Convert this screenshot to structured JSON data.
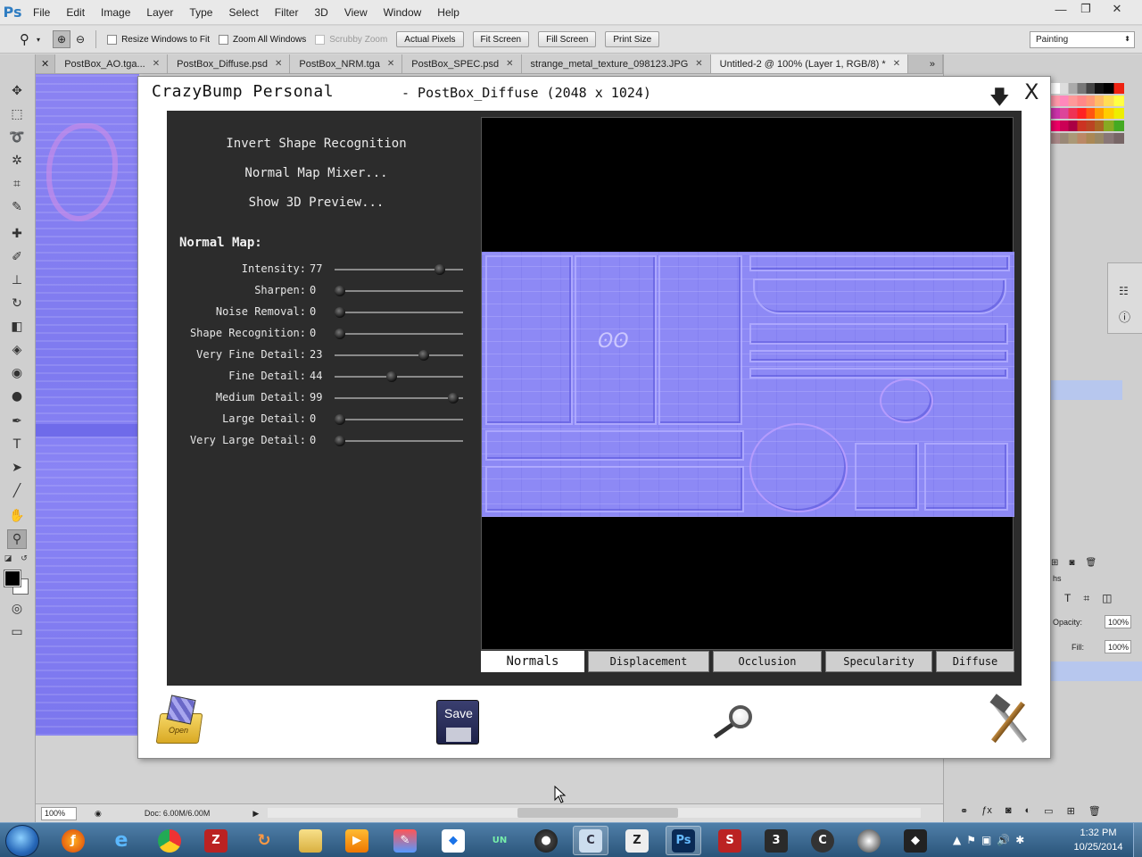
{
  "app": {
    "logo": "Ps"
  },
  "menu": [
    "File",
    "Edit",
    "Image",
    "Layer",
    "Type",
    "Select",
    "Filter",
    "3D",
    "View",
    "Window",
    "Help"
  ],
  "window_controls": {
    "minimize": "—",
    "restore": "❐",
    "close": "✕"
  },
  "options_bar": {
    "resize_windows": "Resize Windows to Fit",
    "zoom_all": "Zoom All Windows",
    "scrubby_zoom": "Scrubby Zoom",
    "actual_pixels": "Actual Pixels",
    "fit_screen": "Fit Screen",
    "fill_screen": "Fill Screen",
    "print_size": "Print Size",
    "workspace": "Painting"
  },
  "tabs": [
    {
      "label": "PostBox_AO.tga..."
    },
    {
      "label": "PostBox_Diffuse.psd"
    },
    {
      "label": "PostBox_NRM.tga"
    },
    {
      "label": "PostBox_SPEC.psd"
    },
    {
      "label": "strange_metal_texture_098123.JPG"
    },
    {
      "label": "Untitled-2 @ 100% (Layer 1, RGB/8) *",
      "active": true
    }
  ],
  "tabs_overflow": "»",
  "status": {
    "zoom": "100%",
    "doc": "Doc: 6.00M/6.00M"
  },
  "right_panel": {
    "opacity_label": "Opacity:",
    "opacity_value": "100%",
    "fill_label": "Fill:",
    "fill_value": "100%",
    "paths_tab": "hs"
  },
  "crazybump": {
    "title": "CrazyBump Personal",
    "file": "- PostBox_Diffuse (2048 x 1024)",
    "links": [
      "Invert Shape Recognition",
      "Normal Map Mixer...",
      "Show 3D Preview..."
    ],
    "heading": "Normal Map:",
    "sliders": [
      {
        "label": "Intensity:",
        "value": "77",
        "level": 0.85
      },
      {
        "label": "Sharpen:",
        "value": "0",
        "level": 0.0
      },
      {
        "label": "Noise Removal:",
        "value": "0",
        "level": 0.0
      },
      {
        "label": "Shape Recognition:",
        "value": "0",
        "level": 0.0
      },
      {
        "label": "Very Fine Detail:",
        "value": "23",
        "level": 0.71
      },
      {
        "label": "Fine Detail:",
        "value": "44",
        "level": 0.44
      },
      {
        "label": "Medium Detail:",
        "value": "99",
        "level": 0.96
      },
      {
        "label": "Large Detail:",
        "value": "0",
        "level": 0.0
      },
      {
        "label": "Very Large Detail:",
        "value": "0",
        "level": 0.0
      }
    ],
    "tabs": [
      {
        "label": "Normals",
        "active": true
      },
      {
        "label": "Displacement"
      },
      {
        "label": "Occlusion"
      },
      {
        "label": "Specularity"
      },
      {
        "label": "Diffuse"
      }
    ],
    "open_label": "Open",
    "save_label": "Save",
    "close_glyph": "X",
    "down_glyph": "🡇"
  },
  "taskbar": {
    "time": "1:32 PM",
    "date": "10/25/2014"
  }
}
